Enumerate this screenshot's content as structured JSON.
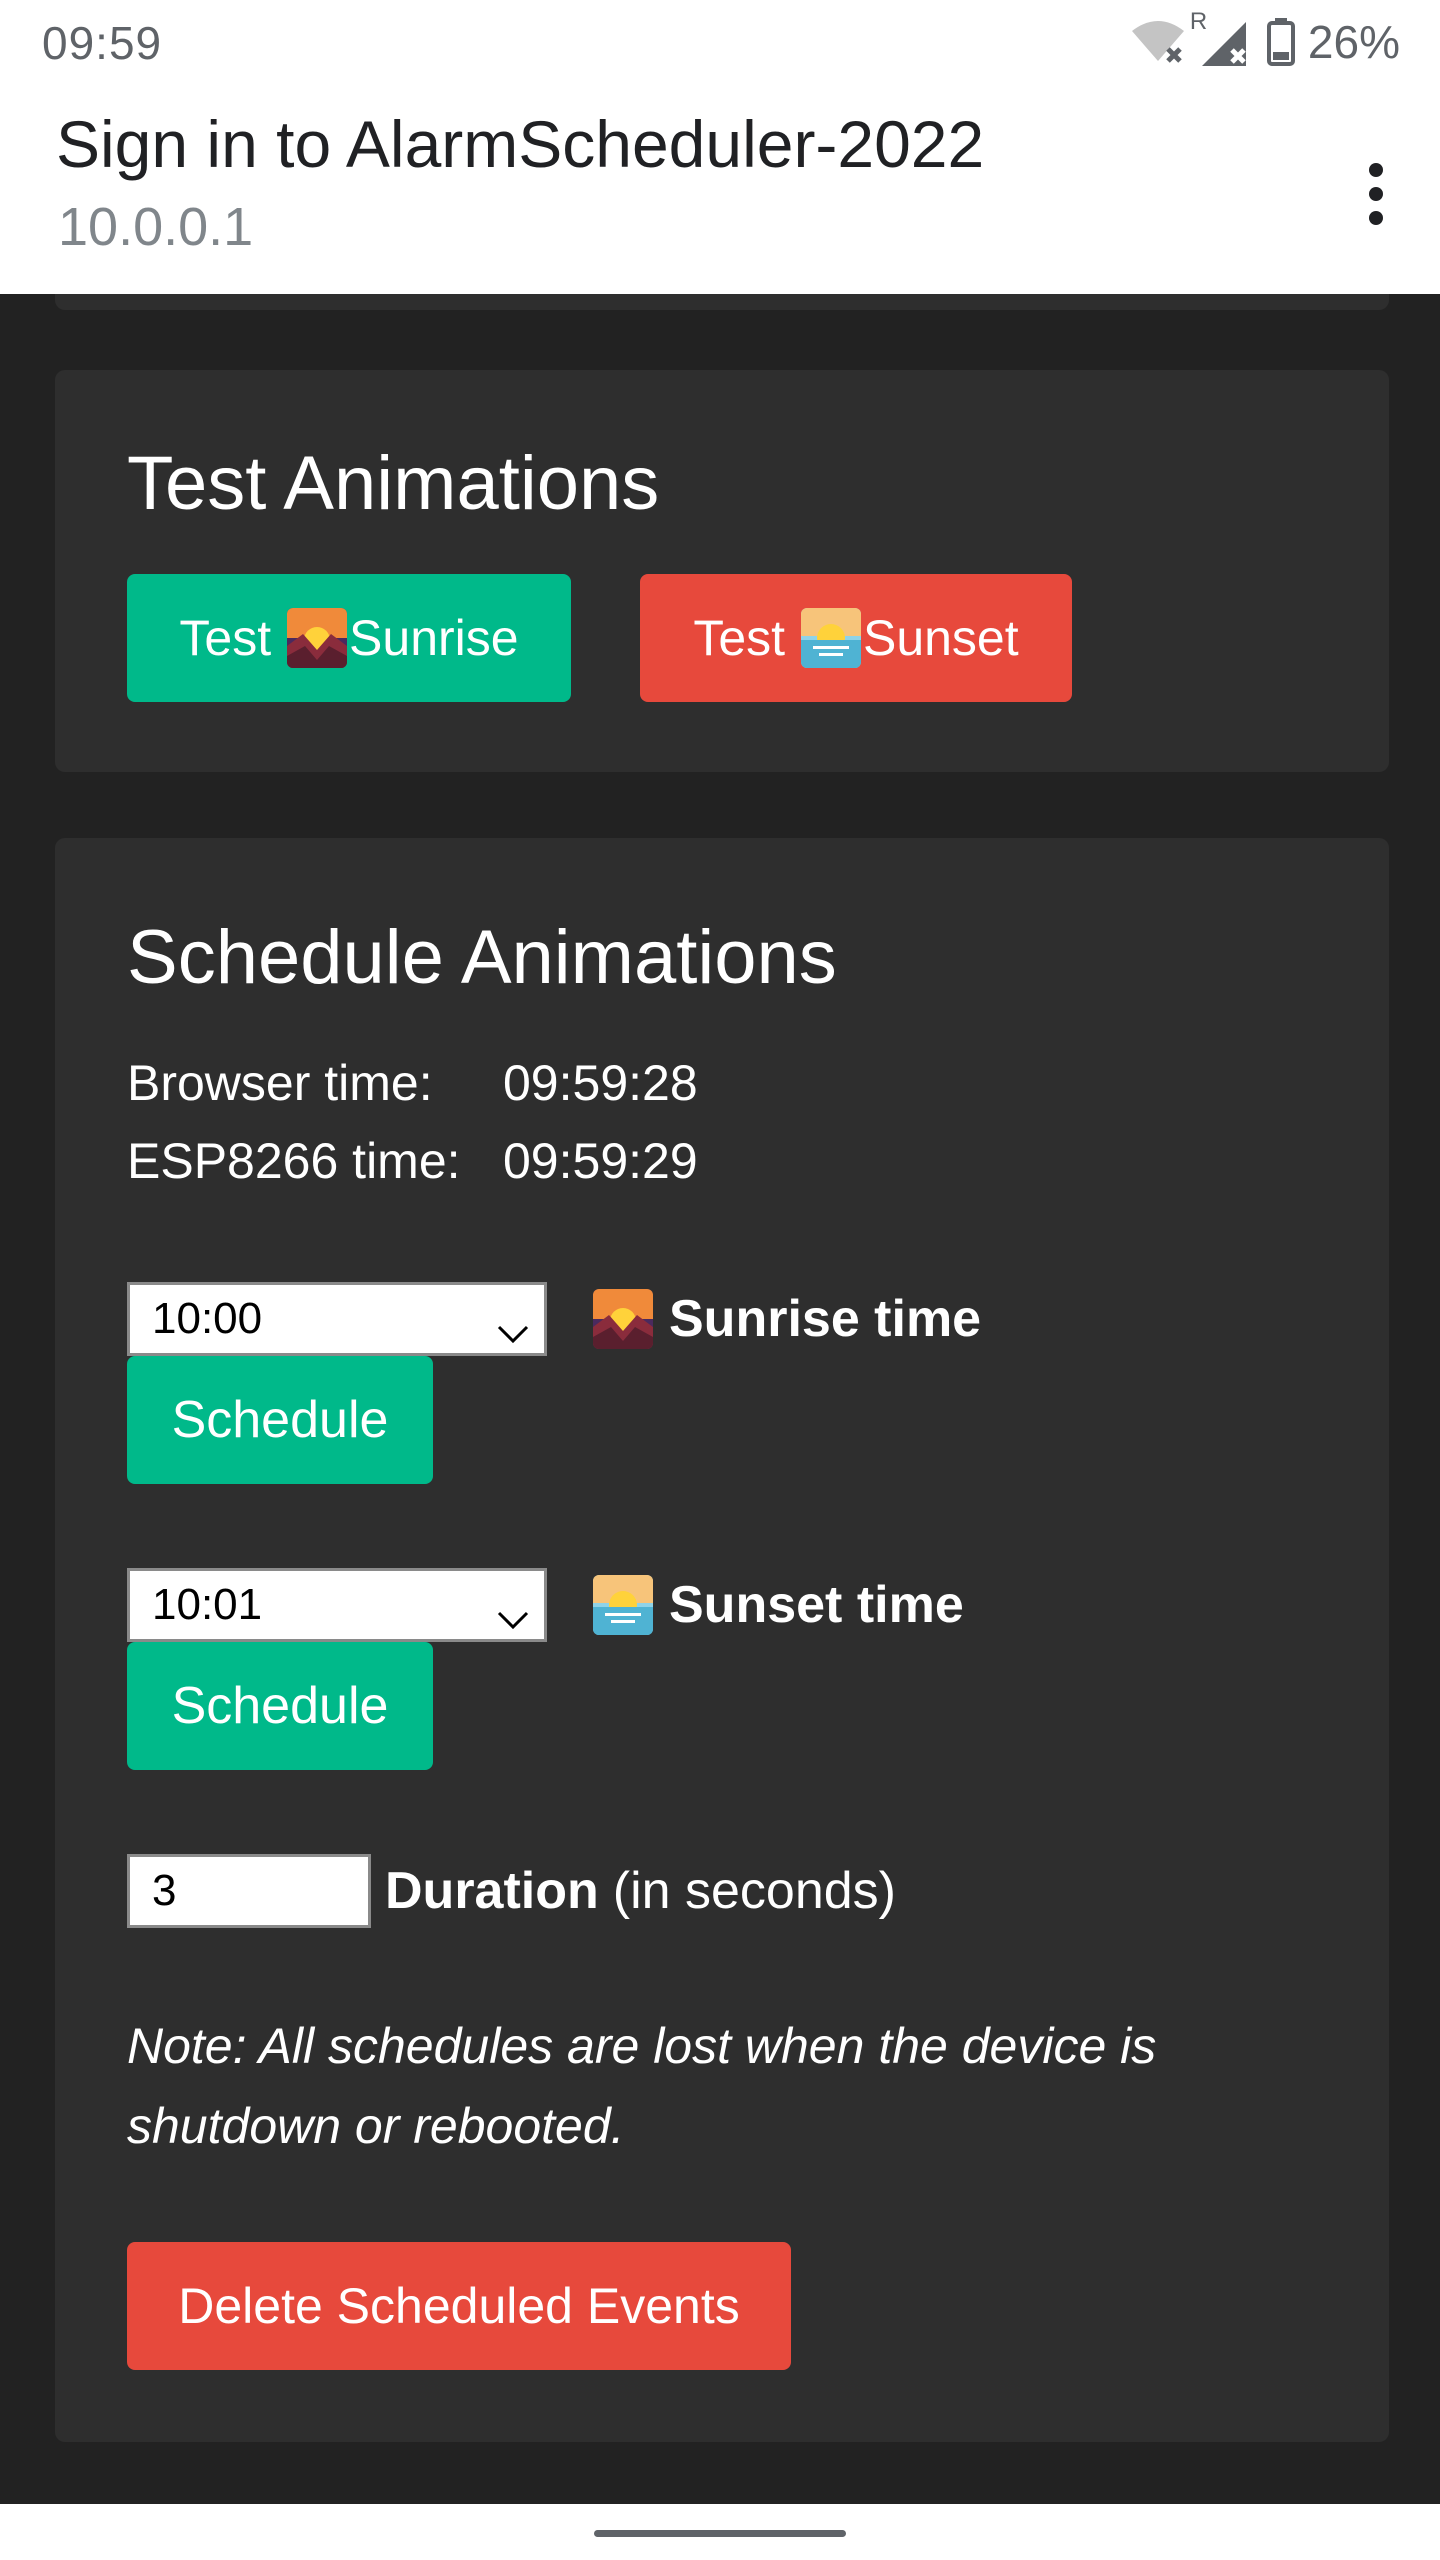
{
  "status_bar": {
    "time": "09:59",
    "battery_percent": "26%",
    "icons": [
      "wifi-off-icon",
      "roaming-signal-off-icon",
      "battery-icon"
    ],
    "roaming_indicator": "R"
  },
  "header": {
    "title": "Sign in to AlarmScheduler-2022",
    "url": "10.0.0.1",
    "menu_icon": "more-vert-icon"
  },
  "test_card": {
    "heading": "Test Animations",
    "sunrise_button": {
      "prefix": "Test",
      "label": "Sunrise",
      "icon": "sunrise-over-mountains-emoji"
    },
    "sunset_button": {
      "prefix": "Test",
      "label": "Sunset",
      "icon": "sunrise-emoji"
    }
  },
  "schedule_card": {
    "heading": "Schedule Animations",
    "browser_time_label": "Browser time:",
    "browser_time_value": "09:59:28",
    "esp_time_label": "ESP8266 time:",
    "esp_time_value": "09:59:29",
    "sunrise_select_value": "10:00",
    "sunrise_label": "Sunrise time",
    "sunset_select_value": "10:01",
    "sunset_label": "Sunset time",
    "schedule_button_label": "Schedule",
    "duration_value": "3",
    "duration_label_bold": "Duration",
    "duration_label_suffix": "(in seconds)",
    "note": "Note: All schedules are lost when the device is shutdown or rebooted.",
    "delete_button_label": "Delete Scheduled Events"
  },
  "colors": {
    "accent_green": "#00b98a",
    "accent_red": "#e7493c",
    "card_bg": "#2e2e2e",
    "page_bg": "#222222"
  }
}
